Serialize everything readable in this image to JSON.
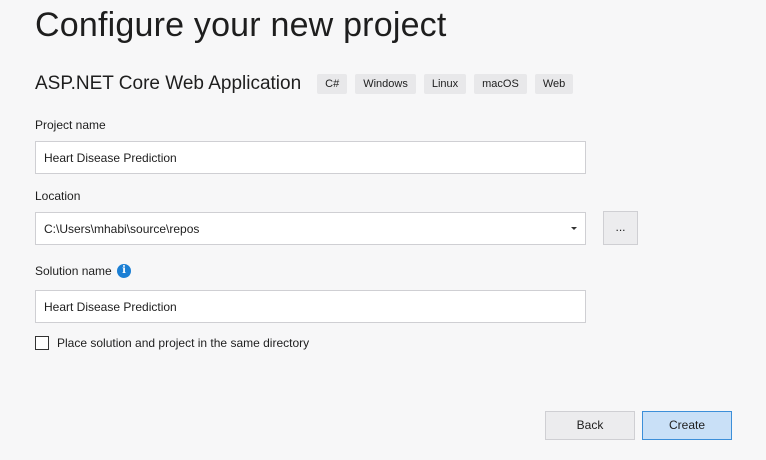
{
  "header": {
    "title": "Configure your new project"
  },
  "template": {
    "name": "ASP.NET Core Web Application",
    "tags": [
      "C#",
      "Windows",
      "Linux",
      "macOS",
      "Web"
    ]
  },
  "form": {
    "project_name": {
      "label": "Project name",
      "value": "Heart Disease Prediction"
    },
    "location": {
      "label": "Location",
      "value": "C:\\Users\\mhabi\\source\\repos",
      "browse_label": "..."
    },
    "solution_name": {
      "label": "Solution name",
      "value": "Heart Disease Prediction",
      "info_icon": "info-icon"
    },
    "same_directory": {
      "label": "Place solution and project in the same directory",
      "checked": false
    }
  },
  "footer": {
    "back_label": "Back",
    "create_label": "Create"
  },
  "colors": {
    "background": "#f7f7f8",
    "accent": "#1b7fd4",
    "primary_button": "#c9e0f7"
  }
}
